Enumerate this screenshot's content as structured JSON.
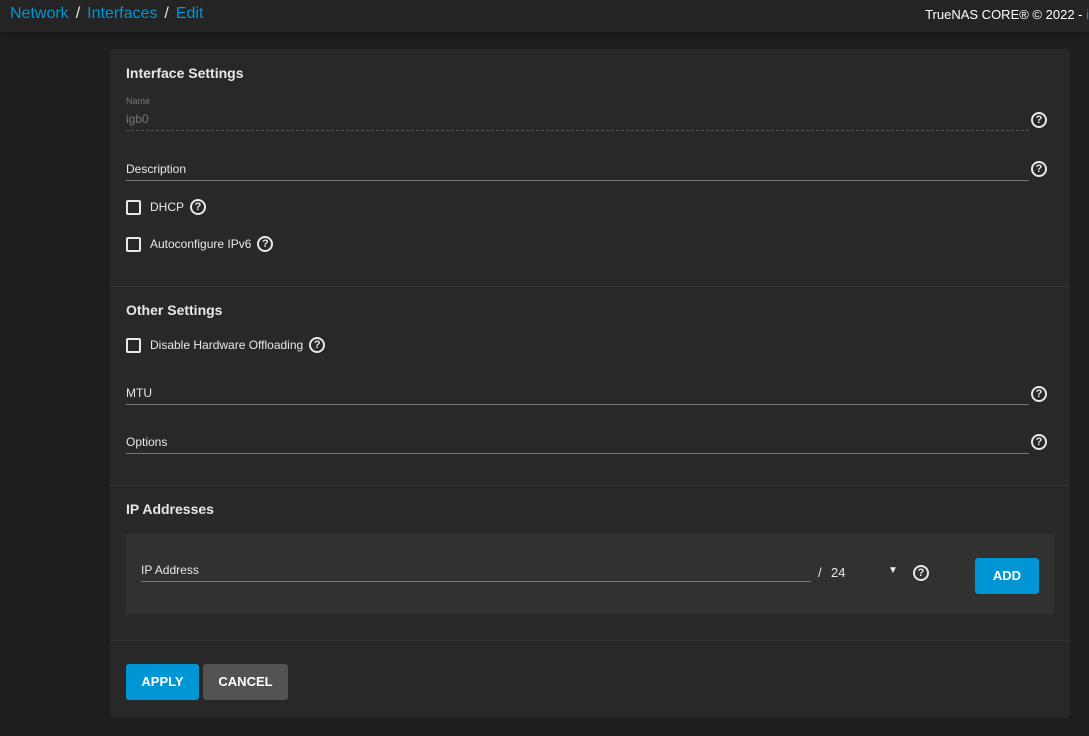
{
  "breadcrumb": [
    "Network",
    "Interfaces",
    "Edit"
  ],
  "copyright": {
    "text": "TrueNAS CORE® © 2022 - ",
    "link": "i"
  },
  "interface_settings": {
    "title": "Interface Settings",
    "name_label": "Name",
    "name_value": "igb0",
    "description_label": "Description",
    "dhcp_label": "DHCP",
    "autoconf_label": "Autoconfigure IPv6"
  },
  "other_settings": {
    "title": "Other Settings",
    "offload_label": "Disable Hardware Offloading",
    "mtu_label": "MTU",
    "options_label": "Options"
  },
  "ip_addresses": {
    "title": "IP Addresses",
    "ip_label": "IP Address",
    "slash": "/",
    "netmask": "24",
    "add_label": "ADD"
  },
  "actions": {
    "apply": "APPLY",
    "cancel": "CANCEL"
  },
  "help_glyph": "?",
  "colors": {
    "accent": "#0095d5",
    "background": "#1e1e1e",
    "card": "#282828"
  }
}
